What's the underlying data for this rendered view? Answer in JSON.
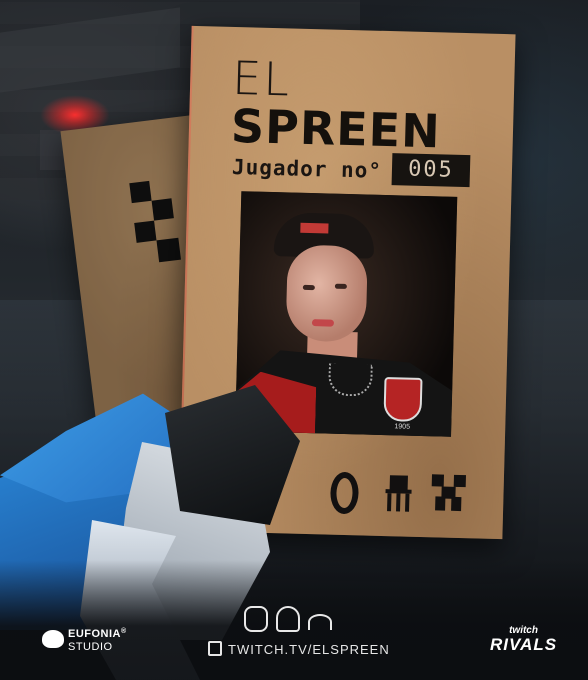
{
  "card": {
    "title_line1": "EL",
    "title_line2": "SPREEN",
    "player_label": "Jugador no°",
    "player_number": "005",
    "photo": {
      "badge_text": "1905"
    },
    "symbols": [
      "circle-icon",
      "triangle-icon",
      "square-icon"
    ]
  },
  "footer": {
    "studio_name": "EUFONIA",
    "studio_trademark": "®",
    "studio_sub": "STUDIO",
    "channel_url": "TWITCH.TV/ELSPREEN",
    "sponsor_top": "twitch",
    "sponsor_main": "RIVALS"
  },
  "colors": {
    "card": "#b98f64",
    "background": "#1b1f24",
    "cube_blue": "#2a86d6"
  }
}
